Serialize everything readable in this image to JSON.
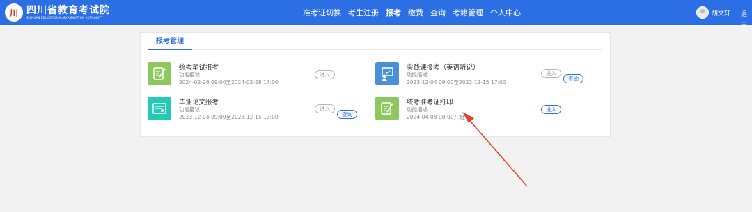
{
  "header": {
    "logo_cn": "四川省教育考试院",
    "logo_en": "SICHUAN EDUCATIONAL EXAMINATION AUTHORITY",
    "nav": [
      "准考证切换",
      "考生注册",
      "报考",
      "缴费",
      "查询",
      "考籍管理",
      "个人中心"
    ],
    "active_nav": "报考",
    "username": "胡文轩",
    "logout": "退出"
  },
  "tab": {
    "label": "报考管理"
  },
  "cards": [
    {
      "title": "统考笔试报考",
      "desc": "功能描述",
      "time": "2024-02-26 09:00至2024-02-28 17:00",
      "enter_label": "进入"
    },
    {
      "title": "实践课报考（英语听说）",
      "desc": "功能描述",
      "time": "2023-12-04 09:00至2023-12-15 17:00",
      "enter_label": "进入",
      "query_label": "查询"
    },
    {
      "title": "毕业论文报考",
      "desc": "功能描述",
      "time": "2023-12-04 09:00至2023-12-15 17:00",
      "enter_label": "进入",
      "query_label": "查询"
    },
    {
      "title": "统考准考证打印",
      "desc": "功能描述",
      "time": "2024-04-08 00:00开始",
      "enter_label": "进入"
    }
  ],
  "colors": {
    "header_bg": "#2c6fe4",
    "icon_green": "#8dc760",
    "icon_blue": "#4a90d9",
    "icon_teal": "#26c9b6",
    "arrow_red": "#e8402a"
  },
  "icons": [
    "pen-paper-icon",
    "teacher-board-icon",
    "certificate-icon",
    "pen-paper-icon"
  ]
}
